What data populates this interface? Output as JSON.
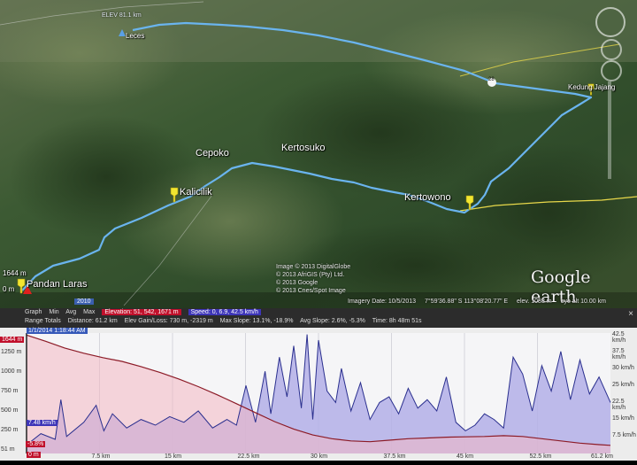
{
  "map": {
    "top_readout": "ELEV 81.1 km",
    "places": {
      "leces": "Leces",
      "kedung_jajang": "Kedung Jajang",
      "cepoko": "Cepoko",
      "kertosuko": "Kertosuko",
      "kalicilik": "Kalicilik",
      "kertowono": "Kertowono",
      "pandan_laras": "Pandan Laras",
      "pin_1644": "1644 m",
      "pin_0m": "0 m"
    },
    "road_number": "28",
    "year_badge": "2010",
    "attribution": [
      "Image © 2013 DigitalGlobe",
      "© 2013 AfriGIS (Pty) Ltd.",
      "© 2013 Google",
      "© 2013 Cnes/Spot Image"
    ],
    "status": {
      "imagery_date": "Imagery Date: 10/5/2013",
      "coords": "7°59'36.88\" S  113°08'20.77\" E",
      "elev": "elev. 1088 m",
      "eye_alt": "eye alt  10.00 km"
    },
    "logo": "Google earth",
    "colors": {
      "track": "#6ab4ee",
      "boundary": "#e8d84a",
      "pin": "#f2e630"
    }
  },
  "profile": {
    "graph_label": "Graph",
    "stats_labels": [
      "Min",
      "Avg",
      "Max"
    ],
    "elevation_chip": "Elevation: 51, 542, 1671 m",
    "speed_chip": "Speed: 0, 6.9, 42.5 km/h",
    "totals_label": "Range Totals",
    "distance": "Distance: 61.2 km",
    "elev_gain_loss": "Elev Gain/Loss: 730 m, -2319 m",
    "max_slope": "Max Slope: 13.1%, -18.9%",
    "avg_slope": "Avg Slope: 2.6%, -5.3%",
    "time": "Time: 8h 48m 51s",
    "date_badge": "1/1/2014 1:18:44 AM",
    "close": "×",
    "cursor_elev": "1644 m",
    "cursor_speed": "7.48 km/h",
    "cursor_slope": "-5.8%",
    "cursor_dist": "0 m"
  },
  "chart_data": {
    "type": "area",
    "xlabel": "",
    "ylabel": "",
    "x_ticks": [
      "7.5 km",
      "15 km",
      "22.5 km",
      "30 km",
      "37.5 km",
      "45 km",
      "52.5 km",
      "61.2 km"
    ],
    "y_left_ticks": [
      "1250 m",
      "1000 m",
      "750 m",
      "500 m",
      "250 m",
      "51 m"
    ],
    "y_right_ticks": [
      "42.5 km/h",
      "37.5 km/h",
      "30 km/h",
      "25 km/h",
      "22.5 km/h",
      "15 km/h",
      "7.5 km/h"
    ],
    "xlim": [
      0,
      61.2
    ],
    "series": [
      {
        "name": "Elevation",
        "unit": "m",
        "ylim": [
          51,
          1671
        ],
        "x": [
          0,
          2,
          4,
          6,
          8,
          10,
          12,
          14,
          16,
          18,
          20,
          22,
          24,
          26,
          28,
          30,
          32,
          34,
          36,
          38,
          40,
          42,
          44,
          46,
          48,
          50,
          52,
          54,
          56,
          58,
          60,
          61.2
        ],
        "values": [
          1644,
          1560,
          1470,
          1400,
          1340,
          1290,
          1220,
          1140,
          1050,
          950,
          840,
          720,
          600,
          480,
          380,
          300,
          250,
          220,
          210,
          230,
          250,
          260,
          270,
          275,
          280,
          290,
          280,
          250,
          220,
          190,
          170,
          160
        ]
      },
      {
        "name": "Speed",
        "unit": "km/h",
        "ylim": [
          0,
          42.5
        ],
        "x": [
          0,
          1.5,
          3,
          3.6,
          4.2,
          6,
          7.3,
          8.1,
          9,
          10.5,
          12,
          13.5,
          15,
          16.5,
          18,
          19.5,
          21,
          22,
          23,
          24,
          25,
          25.6,
          26.5,
          27.3,
          28,
          28.8,
          29.4,
          30,
          30.6,
          31.5,
          32.4,
          33,
          34,
          35,
          36,
          37,
          38,
          39,
          40,
          41,
          42,
          43,
          44,
          45,
          46,
          47,
          48,
          49,
          50,
          51,
          52,
          53,
          54,
          55,
          56,
          57,
          58,
          59,
          60,
          61.2
        ],
        "values": [
          3,
          7,
          5,
          19,
          6,
          11,
          17,
          8,
          14,
          9,
          12,
          10,
          13,
          11,
          15,
          9,
          12,
          10,
          24,
          11,
          29,
          14,
          34,
          20,
          38,
          16,
          42,
          12,
          40,
          22,
          18,
          30,
          15,
          25,
          12,
          18,
          20,
          14,
          23,
          16,
          19,
          15,
          27,
          11,
          8,
          10,
          14,
          12,
          9,
          34,
          28,
          15,
          31,
          22,
          36,
          19,
          33,
          21,
          27,
          18
        ]
      }
    ],
    "colors": {
      "elevation_line": "#8c1b27",
      "elevation_fill": "#f3b6c3",
      "speed_line": "#2a2f8e",
      "speed_fill": "#b3afe8"
    }
  }
}
